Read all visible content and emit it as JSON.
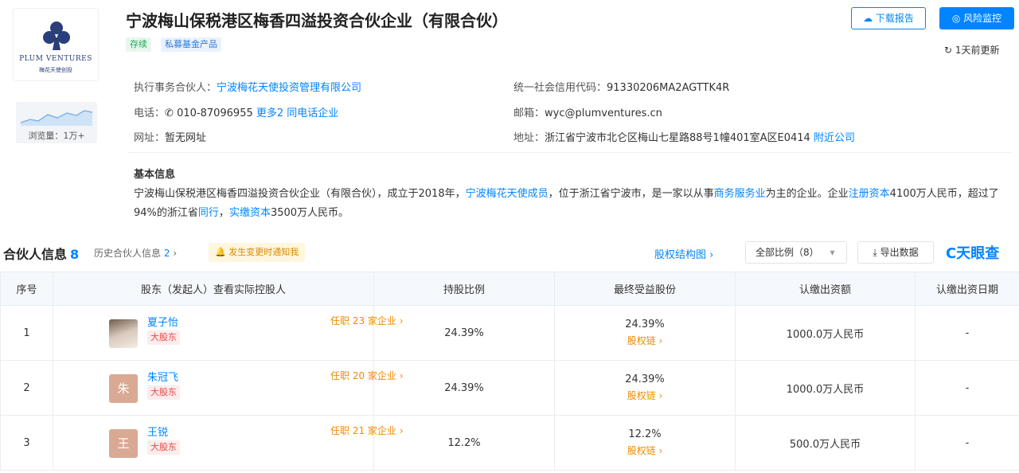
{
  "company": {
    "logo_text": "PLUM VENTURES",
    "logo_sub": "梅花天使创投",
    "views_label": "浏览量：1万+",
    "title": "宁波梅山保税港区梅香四溢投资合伙企业（有限合伙）",
    "status_tag": "存续",
    "type_tag": "私募基金产品"
  },
  "actions": {
    "download_label": "下载报告",
    "monitor_label": "风险监控",
    "updated": "1天前更新"
  },
  "info": {
    "partner_label": "执行事务合伙人：",
    "partner_value": "宁波梅花天使投资管理有限公司",
    "credit_label": "统一社会信用代码：",
    "credit_value": "91330206MA2AGTTK4R",
    "phone_label": "电话：",
    "phone_value": "010-87096955",
    "phone_more": "更多2",
    "phone_same": "同电话企业",
    "email_label": "邮箱：",
    "email_value": "wyc@plumventures.cn",
    "site_label": "网址：",
    "site_value": "暂无网址",
    "address_label": "地址：",
    "address_value": "浙江省宁波市北仑区梅山七星路88号1幢401室A区E0414",
    "address_near": "附近公司"
  },
  "basic": {
    "title": "基本信息",
    "text_1": "宁波梅山保税港区梅香四溢投资合伙企业（有限合伙），成立于2018年，",
    "text_link_1": "宁波梅花天使成员",
    "text_2": "，位于浙江省宁波市，是一家以从事",
    "text_link_2": "商务服务业",
    "text_3": "为主的企业。企业",
    "text_link_3": "注册资本",
    "text_4": "4100万人民币，超过了94%的浙江省",
    "text_link_4": "同行",
    "text_5": "，",
    "text_link_5": "实缴资本",
    "text_6": "3500万人民币。"
  },
  "partners": {
    "title": "合伙人信息",
    "count": "8",
    "history_label": "历史合伙人信息",
    "history_count": "2",
    "warn_tag": "发生变更时通知我",
    "structure_link": "股权结构图 ›",
    "ratio_select": "全部比例（8）",
    "export_label": "导出数据",
    "brand": "天眼查",
    "columns": [
      "序号",
      "股东（发起人）查看实际控股人",
      "持股比例",
      "最终受益股份",
      "认缴出资额",
      "认缴出资日期"
    ],
    "rows": [
      {
        "index": "1",
        "avatar": "",
        "name": "夏子怡",
        "badge": "大股东",
        "roles": "任职 23 家企业 ›",
        "ratio": "24.39%",
        "final_ratio": "24.39%",
        "chain": "股权链 ›",
        "capital": "1000.0万人民币",
        "date": "-"
      },
      {
        "index": "2",
        "avatar": "朱",
        "name": "朱冠飞",
        "badge": "大股东",
        "roles": "任职 20 家企业 ›",
        "ratio": "24.39%",
        "final_ratio": "24.39%",
        "chain": "股权链 ›",
        "capital": "1000.0万人民币",
        "date": "-"
      },
      {
        "index": "3",
        "avatar": "王",
        "name": "王锐",
        "badge": "大股东",
        "roles": "任职 21 家企业 ›",
        "ratio": "12.2%",
        "final_ratio": "12.2%",
        "chain": "股权链 ›",
        "capital": "500.0万人民币",
        "date": "-"
      }
    ]
  },
  "colors": {
    "accent": "#0084ff",
    "status_green": "#1aaa55",
    "badge_red": "#e8494a",
    "orange": "#f08a00"
  }
}
